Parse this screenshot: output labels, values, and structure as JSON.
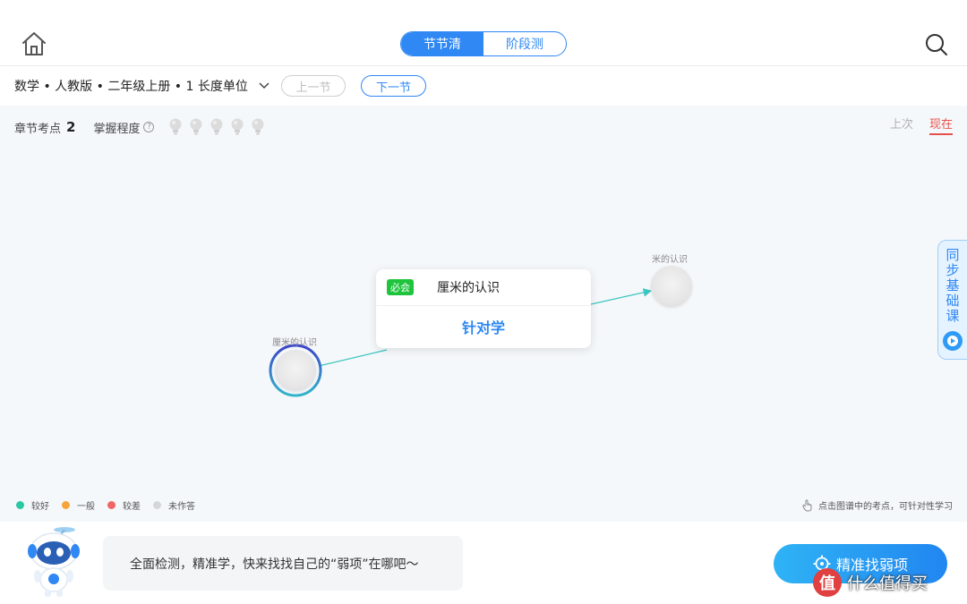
{
  "header": {
    "tabs": [
      {
        "label": "节节清",
        "active": true
      },
      {
        "label": "阶段测",
        "active": false
      }
    ]
  },
  "crumb": {
    "course": "数学 • 人教版 • 二年级上册 • 1 长度单位",
    "prev_label": "上一节",
    "next_label": "下一节"
  },
  "stats": {
    "points_label": "章节考点",
    "points_count": "2",
    "mastery_label": "掌握程度",
    "help_glyph": "?",
    "bulbs": 5
  },
  "time_toggle": {
    "prev_label": "上次",
    "now_label": "现在"
  },
  "graph": {
    "nodes": [
      {
        "label": "厘米的认识",
        "state": "current"
      },
      {
        "label": "米的认识",
        "state": "not-done"
      }
    ],
    "popup": {
      "badge": "必会",
      "title": "厘米的认识",
      "action": "针对学"
    }
  },
  "legend": [
    {
      "label": "较好",
      "color": "#2dc7a4"
    },
    {
      "label": "一般",
      "color": "#f7a53b"
    },
    {
      "label": "较差",
      "color": "#f16565"
    },
    {
      "label": "未作答",
      "color": "#d4d6d8"
    }
  ],
  "hint": "点击图谱中的考点，可针对性学习",
  "side_tab": {
    "label": "同步基础课"
  },
  "bottom": {
    "bubble_text": "全面检测，精准学，快来找找自己的“弱项”在哪吧～",
    "cta_label": "精准找弱项"
  },
  "watermark": {
    "logo": "值",
    "text": "什么值得买"
  },
  "colors": {
    "accent": "#2f88f3",
    "now": "#e8514a",
    "must_badge": "#1fc43d"
  }
}
